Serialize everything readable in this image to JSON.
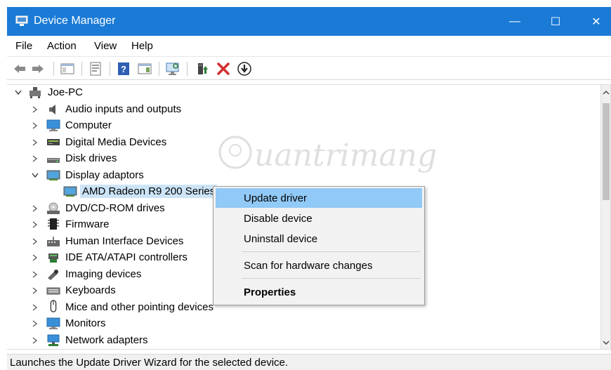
{
  "window": {
    "title": "Device Manager",
    "controls": {
      "minimize": "—",
      "maximize": "☐",
      "close": "✕"
    }
  },
  "menubar": {
    "items": [
      "File",
      "Action",
      "View",
      "Help"
    ]
  },
  "toolbar": {
    "buttons": [
      {
        "name": "back-icon"
      },
      {
        "name": "forward-icon"
      },
      {
        "name": "show-hide-console-tree-icon"
      },
      {
        "name": "properties-icon"
      },
      {
        "name": "help-icon"
      },
      {
        "name": "action-pane-icon"
      },
      {
        "name": "scan-hardware-icon"
      },
      {
        "name": "update-driver-icon"
      },
      {
        "name": "uninstall-device-icon"
      },
      {
        "name": "enable-device-icon"
      }
    ],
    "colors": {
      "uninstall_red": "#d32f2f",
      "help_blue": "#2f5fb3",
      "update_green": "#2e7d32"
    }
  },
  "tree": {
    "root": "Joe-PC",
    "items": [
      {
        "label": "Audio inputs and outputs",
        "icon": "speaker-icon",
        "expanded": false
      },
      {
        "label": "Computer",
        "icon": "monitor-icon",
        "expanded": false
      },
      {
        "label": "Digital Media Devices",
        "icon": "media-device-icon",
        "expanded": false
      },
      {
        "label": "Disk drives",
        "icon": "disk-drive-icon",
        "expanded": false
      },
      {
        "label": "Display adaptors",
        "icon": "display-adapter-icon",
        "expanded": true
      },
      {
        "label": "AMD Radeon R9 200 Series",
        "icon": "display-adapter-icon",
        "child": true
      },
      {
        "label": "DVD/CD-ROM drives",
        "icon": "dvd-drive-icon",
        "expanded": false
      },
      {
        "label": "Firmware",
        "icon": "chip-icon",
        "expanded": false
      },
      {
        "label": "Human Interface Devices",
        "icon": "hid-icon",
        "expanded": false
      },
      {
        "label": "IDE ATA/ATAPI controllers",
        "icon": "ide-controller-icon",
        "expanded": false
      },
      {
        "label": "Imaging devices",
        "icon": "camera-icon",
        "expanded": false
      },
      {
        "label": "Keyboards",
        "icon": "keyboard-icon",
        "expanded": false
      },
      {
        "label": "Mice and other pointing devices",
        "icon": "mouse-icon",
        "expanded": false
      },
      {
        "label": "Monitors",
        "icon": "monitor-icon",
        "expanded": false
      },
      {
        "label": "Network adapters",
        "icon": "network-adapter-icon",
        "expanded": false
      }
    ]
  },
  "context_menu": {
    "items": [
      {
        "label": "Update driver",
        "highlighted": true
      },
      {
        "label": "Disable device"
      },
      {
        "label": "Uninstall device"
      },
      {
        "label": "Scan for hardware changes"
      },
      {
        "label": "Properties",
        "bold": true
      }
    ],
    "highlight_color": "#91c9f7"
  },
  "watermark": {
    "text": "uantrimang"
  },
  "status": {
    "text": "Launches the Update Driver Wizard for the selected device."
  },
  "colors": {
    "titlebar": "#1a7ad6",
    "selection": "#cce4f7"
  }
}
